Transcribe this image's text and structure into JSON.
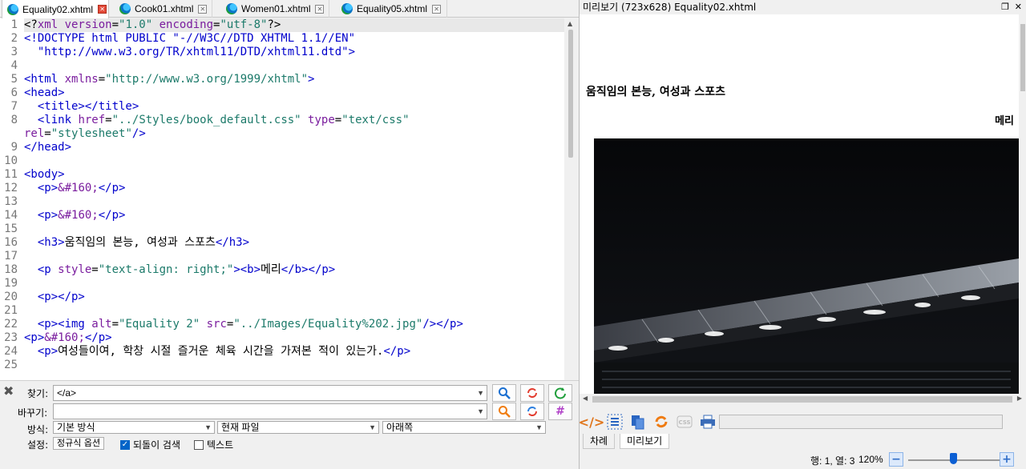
{
  "tabs": [
    {
      "label": "Equality02.xhtml",
      "active": true
    },
    {
      "label": "Cook01.xhtml",
      "active": false
    },
    {
      "label": "Women01.xhtml",
      "active": false
    },
    {
      "label": "Equality05.xhtml",
      "active": false
    }
  ],
  "code_lines": [
    [
      [
        "p",
        "<?"
      ],
      [
        "a",
        "xml version"
      ],
      [
        "p",
        "="
      ],
      [
        "v",
        "\"1.0\""
      ],
      [
        "a",
        " encoding"
      ],
      [
        "p",
        "="
      ],
      [
        "v",
        "\"utf-8\""
      ],
      [
        "p",
        "?>"
      ]
    ],
    [
      [
        "t",
        "<!DOCTYPE html PUBLIC \"-//W3C//DTD XHTML 1.1//EN\""
      ]
    ],
    [
      [
        "t",
        "  \"http://www.w3.org/TR/xhtml11/DTD/xhtml11.dtd\">"
      ]
    ],
    [],
    [
      [
        "t",
        "<html"
      ],
      [
        "a",
        " xmlns"
      ],
      [
        "p",
        "="
      ],
      [
        "v",
        "\"http://www.w3.org/1999/xhtml\""
      ],
      [
        "t",
        ">"
      ]
    ],
    [
      [
        "t",
        "<head>"
      ]
    ],
    [
      [
        "t",
        "  <title></title>"
      ]
    ],
    [
      [
        "t",
        "  <link"
      ],
      [
        "a",
        " href"
      ],
      [
        "p",
        "="
      ],
      [
        "v",
        "\"../Styles/book_default.css\""
      ],
      [
        "a",
        " type"
      ],
      [
        "p",
        "="
      ],
      [
        "v",
        "\"text/css\""
      ]
    ],
    [
      [
        "a",
        "rel"
      ],
      [
        "p",
        "="
      ],
      [
        "v",
        "\"stylesheet\""
      ],
      [
        "t",
        "/>"
      ]
    ],
    [
      [
        "t",
        "</head>"
      ]
    ],
    [],
    [
      [
        "t",
        "<body>"
      ]
    ],
    [
      [
        "t",
        "  <p>"
      ],
      [
        "a",
        "&#160;"
      ],
      [
        "t",
        "</p>"
      ]
    ],
    [],
    [
      [
        "t",
        "  <p>"
      ],
      [
        "a",
        "&#160;"
      ],
      [
        "t",
        "</p>"
      ]
    ],
    [],
    [
      [
        "t",
        "  <h3>"
      ],
      [
        "p",
        "움직임의 본능, 여성과 스포츠"
      ],
      [
        "t",
        "</h3>"
      ]
    ],
    [],
    [
      [
        "t",
        "  <p"
      ],
      [
        "a",
        " style"
      ],
      [
        "p",
        "="
      ],
      [
        "v",
        "\"text-align: right;\""
      ],
      [
        "t",
        "><b>"
      ],
      [
        "p",
        "메리"
      ],
      [
        "t",
        "</b></p>"
      ]
    ],
    [],
    [
      [
        "t",
        "  <p></p>"
      ]
    ],
    [],
    [
      [
        "t",
        "  <p><img"
      ],
      [
        "a",
        " alt"
      ],
      [
        "p",
        "="
      ],
      [
        "v",
        "\"Equality 2\""
      ],
      [
        "a",
        " src"
      ],
      [
        "p",
        "="
      ],
      [
        "v",
        "\"../Images/Equality%202.jpg\""
      ],
      [
        "t",
        "/></p>"
      ]
    ],
    [
      [
        "t",
        "<p>"
      ],
      [
        "a",
        "&#160;"
      ],
      [
        "t",
        "</p>"
      ]
    ],
    [
      [
        "t",
        "  <p>"
      ],
      [
        "p",
        "여성들이여, 학창 시절 즐거운 체육 시간을 가져본 적이 있는가."
      ],
      [
        "t",
        "</p>"
      ]
    ],
    []
  ],
  "line_numbers": [
    "1",
    "2",
    "3",
    "4",
    "5",
    "6",
    "7",
    "8",
    "",
    "9",
    "10",
    "11",
    "12",
    "13",
    "14",
    "15",
    "16",
    "17",
    "18",
    "19",
    "20",
    "21",
    "22",
    "23",
    "24",
    "25"
  ],
  "find": {
    "find_label": "찾기:",
    "find_value": "</a>",
    "replace_label": "바꾸기:",
    "replace_value": "",
    "mode_label": "방식:",
    "mode_value": "기본 방식",
    "scope_value": "현재 파일",
    "direction_value": "아래쪽",
    "settings_label": "설정:",
    "regex_button": "정규식 옵션",
    "wrap_label": "되돌이 검색",
    "wrap_checked": true,
    "text_label": "텍스트",
    "text_checked": false
  },
  "preview": {
    "title": "미리보기 (723x628) Equality02.xhtml",
    "heading": "움직임의 본능, 여성과 스포츠",
    "author": "메리",
    "bottom_tabs": [
      "차례",
      "미리보기"
    ]
  },
  "status": {
    "position": "행: 1, 열: 3",
    "zoom": "120%",
    "zoom_fraction": 0.6
  },
  "colors": {
    "tag": "#0000cc",
    "attr": "#7a1d9e",
    "value": "#1c7a6a",
    "accent": "#0c5fd3"
  }
}
